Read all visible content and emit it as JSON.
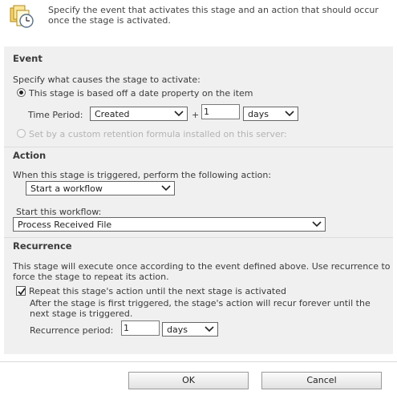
{
  "header": {
    "description": "Specify the event that activates this stage and an action that should occur once the stage is activated."
  },
  "event": {
    "title": "Event",
    "prompt": "Specify what causes the stage to activate:",
    "date_option_label": "This stage is based off a date property on the item",
    "time_period_label": "Time Period:",
    "time_period_value": "Created",
    "plus_sign": "+",
    "offset_value": "1",
    "unit_value": "days",
    "custom_option_label": "Set by a custom retention formula installed on this server:"
  },
  "action": {
    "title": "Action",
    "prompt": "When this stage is triggered, perform the following action:",
    "action_value": "Start a workflow",
    "workflow_label": "Start this workflow:",
    "workflow_value": "Process Received File"
  },
  "recurrence": {
    "title": "Recurrence",
    "description": "This stage will execute once according to the event defined above. Use recurrence to force the stage to repeat its action.",
    "repeat_label": "Repeat this stage's action until the next stage is activated",
    "repeat_note": "After the stage is first triggered, the stage's action will recur forever until the next stage is triggered.",
    "period_label": "Recurrence period:",
    "period_value": "1",
    "period_unit": "days"
  },
  "footer": {
    "ok_label": "OK",
    "cancel_label": "Cancel"
  }
}
